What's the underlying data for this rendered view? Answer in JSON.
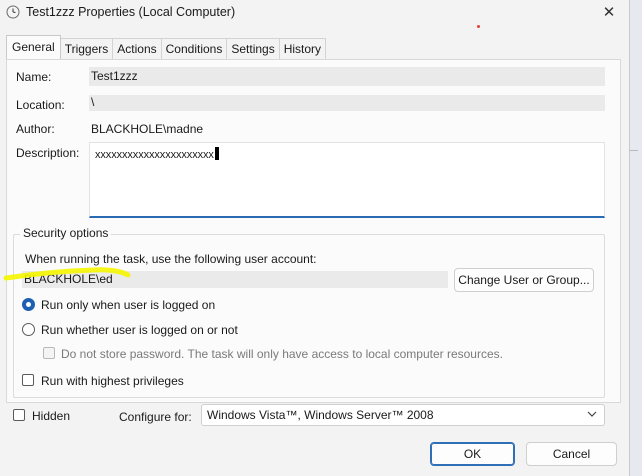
{
  "window": {
    "title": "Test1zzz Properties (Local Computer)",
    "close_glyph": "✕",
    "icon": "clock-icon"
  },
  "tabs": [
    {
      "label": "General",
      "active": true
    },
    {
      "label": "Triggers"
    },
    {
      "label": "Actions"
    },
    {
      "label": "Conditions"
    },
    {
      "label": "Settings"
    },
    {
      "label": "History"
    }
  ],
  "general": {
    "name_label": "Name:",
    "name_value": "Test1zzz",
    "location_label": "Location:",
    "location_value": "\\",
    "author_label": "Author:",
    "author_value": "BLACKHOLE\\madne",
    "description_label": "Description:",
    "description_value": "xxxxxxxxxxxxxxxxxxxxxx"
  },
  "security": {
    "group_title": "Security options",
    "account_prompt": "When running the task, use the following user account:",
    "account_value": "BLACKHOLE\\ed",
    "change_button": "Change User or Group...",
    "radio_logged_on": "Run only when user is logged on",
    "radio_whether": "Run whether user is logged on or not",
    "no_store_password": "Do not store password.  The task will only have access to local computer resources.",
    "highest_privileges": "Run with highest privileges"
  },
  "footer": {
    "hidden_label": "Hidden",
    "configure_label": "Configure for:",
    "configure_value": "Windows Vista™, Windows Server™ 2008",
    "ok_button": "OK",
    "cancel_button": "Cancel"
  },
  "colors": {
    "accent": "#1f5fb3",
    "highlight_marker": "#f5f500"
  }
}
